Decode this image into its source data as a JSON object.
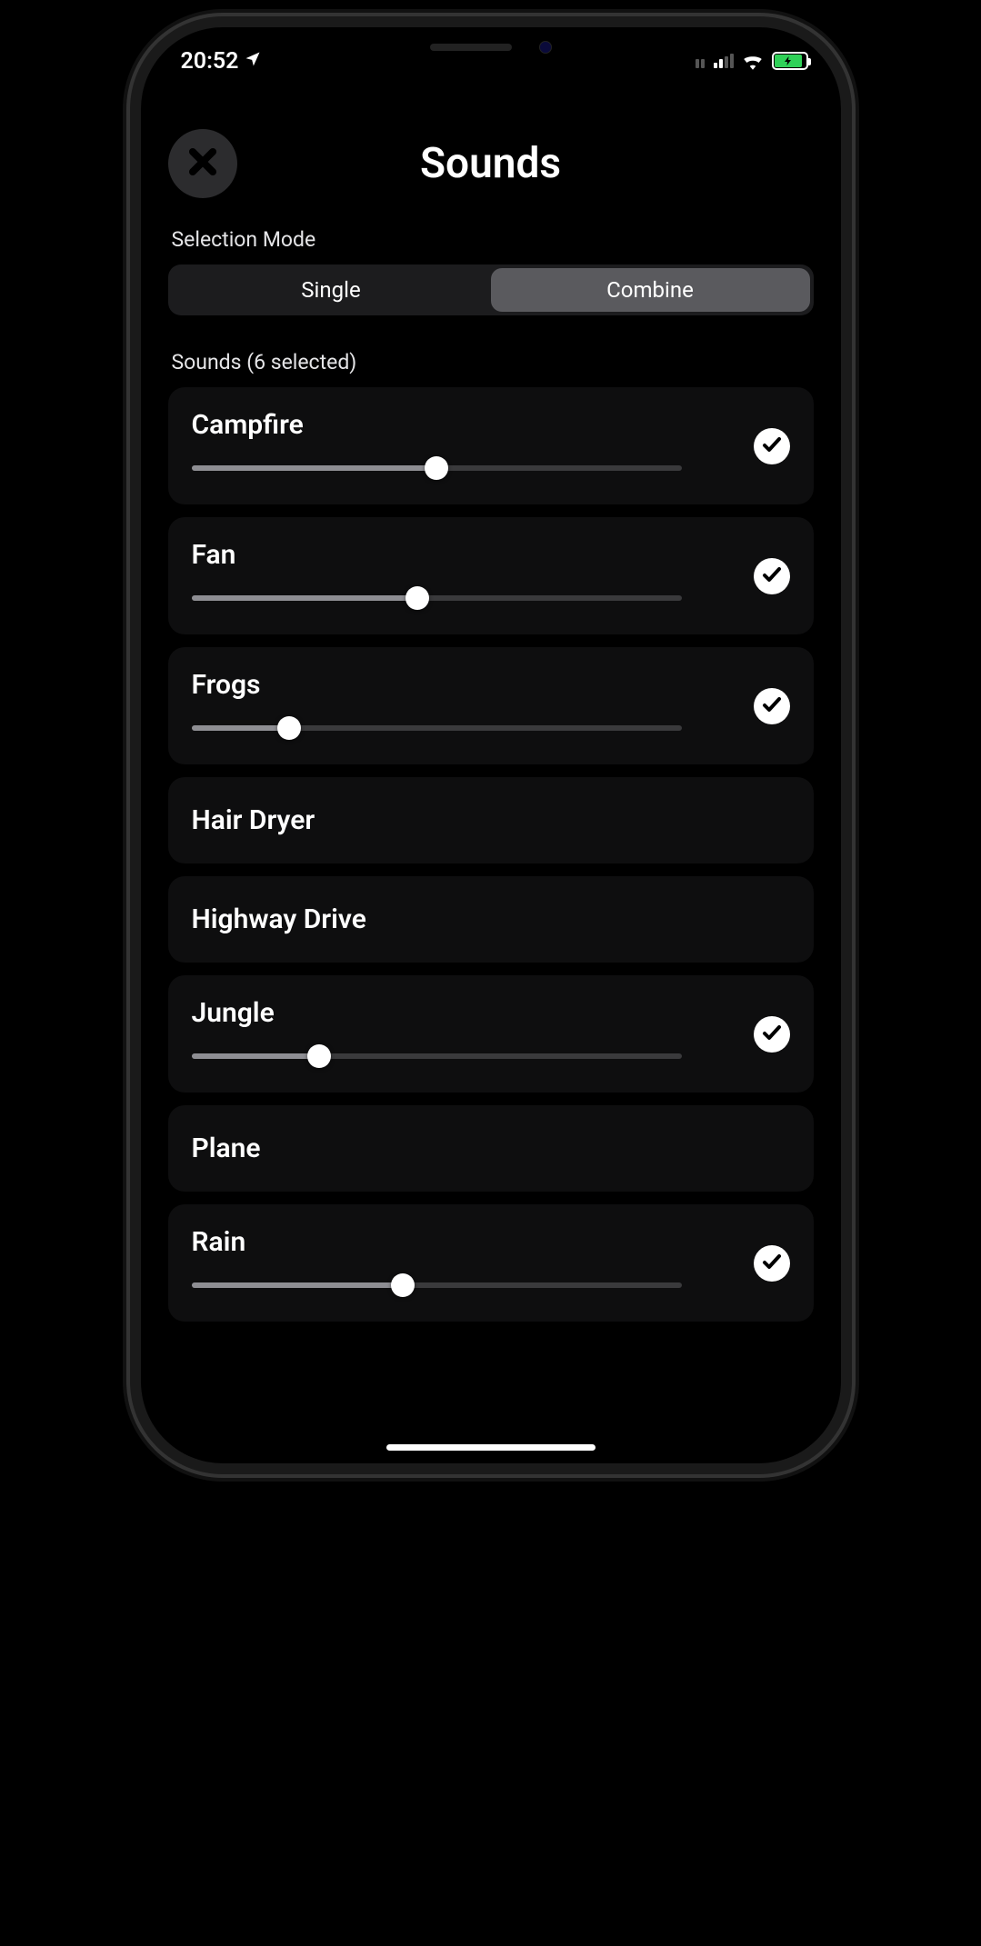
{
  "statusbar": {
    "time": "20:52"
  },
  "header": {
    "title": "Sounds"
  },
  "selection_mode": {
    "label": "Selection Mode",
    "options": [
      {
        "label": "Single",
        "active": false
      },
      {
        "label": "Combine",
        "active": true
      }
    ]
  },
  "sounds": {
    "header": "Sounds (6 selected)",
    "items": [
      {
        "name": "Campfire",
        "selected": true,
        "value": 50
      },
      {
        "name": "Fan",
        "selected": true,
        "value": 46
      },
      {
        "name": "Frogs",
        "selected": true,
        "value": 20
      },
      {
        "name": "Hair Dryer",
        "selected": false,
        "value": null
      },
      {
        "name": "Highway Drive",
        "selected": false,
        "value": null
      },
      {
        "name": "Jungle",
        "selected": true,
        "value": 26
      },
      {
        "name": "Plane",
        "selected": false,
        "value": null
      },
      {
        "name": "Rain",
        "selected": true,
        "value": 43
      }
    ]
  }
}
